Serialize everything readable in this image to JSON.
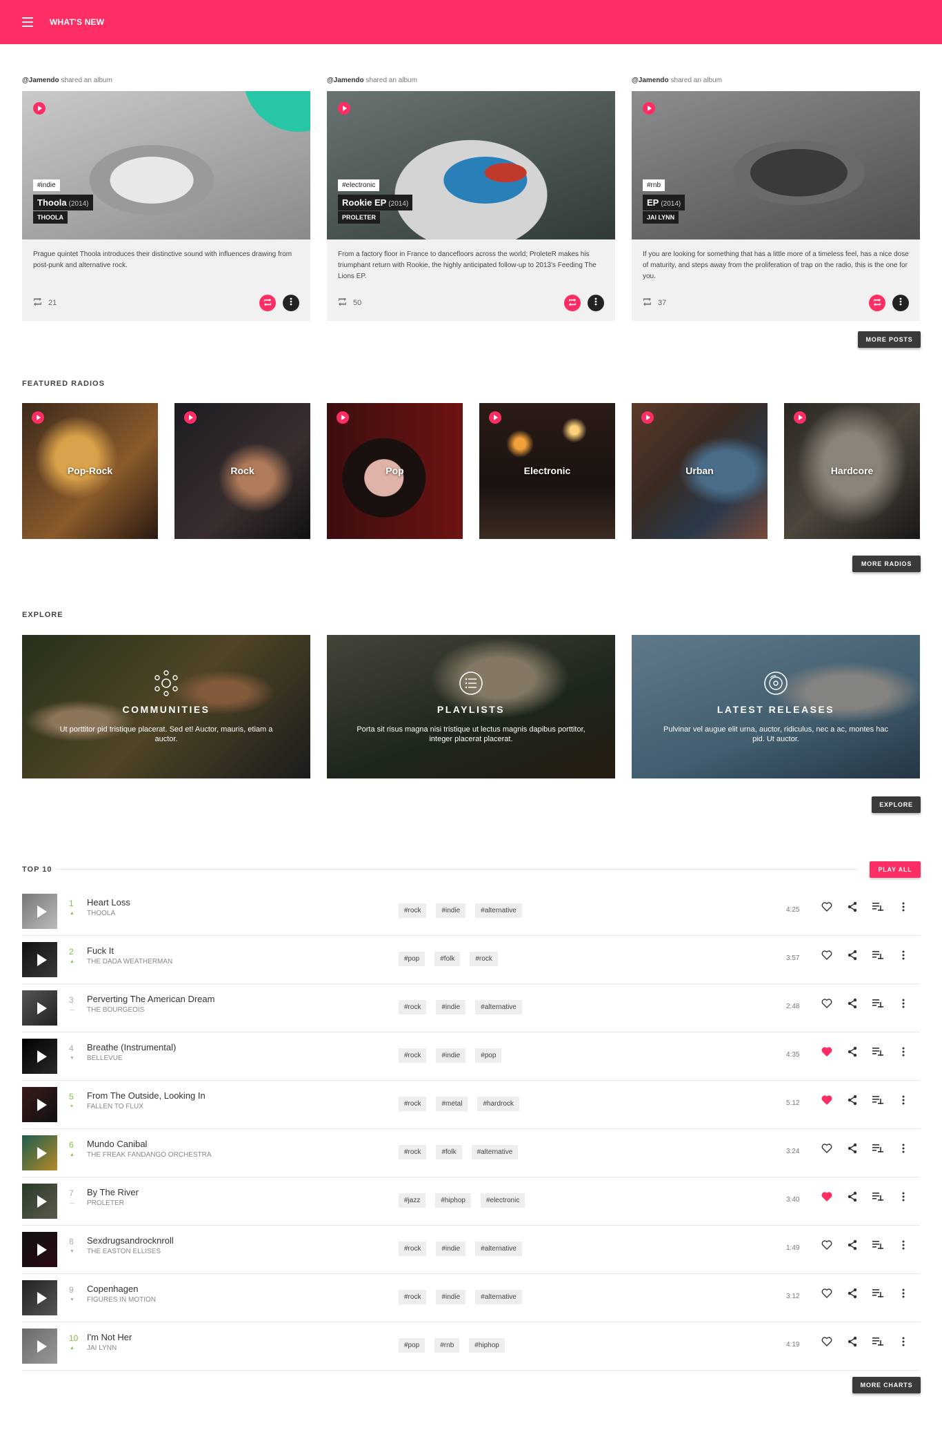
{
  "header": {
    "title": "WHAT'S NEW"
  },
  "posts": [
    {
      "user": "@Jamendo",
      "action": "shared an album",
      "tag": "#indie",
      "album": "Thoola",
      "year": "(2014)",
      "artist": "THOOLA",
      "description": "Prague quintet Thoola introduces their distinctive sound with influences drawing from post-punk and alternative rock.",
      "reposts": "21"
    },
    {
      "user": "@Jamendo",
      "action": "shared an album",
      "tag": "#electronic",
      "album": "Rookie EP",
      "year": "(2014)",
      "artist": "PROLETER",
      "description": "From a factory floor in France to dancefloors across the world; ProleteR makes his triumphant return with Rookie, the highly anticipated follow-up to 2013's Feeding The Lions EP.",
      "reposts": "50"
    },
    {
      "user": "@Jamendo",
      "action": "shared an album",
      "tag": "#rnb",
      "album": "EP",
      "year": "(2014)",
      "artist": "JAI LYNN",
      "description": "If you are looking for something that has a little more of a timeless feel, has a nice dose of maturity, and steps away from the proliferation of trap on the radio, this is the one for you.",
      "reposts": "37"
    }
  ],
  "more_posts": "MORE POSTS",
  "featured_radios": {
    "title": "FEATURED RADIOS",
    "items": [
      "Pop-Rock",
      "Rock",
      "Pop",
      "Electronic",
      "Urban",
      "Hardcore"
    ],
    "more": "MORE RADIOS"
  },
  "explore": {
    "title": "EXPLORE",
    "items": [
      {
        "title": "COMMUNITIES",
        "desc": "Ut porttitor pid tristique placerat. Sed et! Auctor, mauris, etiam a auctor."
      },
      {
        "title": "PLAYLISTS",
        "desc": "Porta sit risus magna nisi tristique ut lectus magnis dapibus porttitor, integer placerat placerat."
      },
      {
        "title": "LATEST RELEASES",
        "desc": "Pulvinar vel augue elit urna, auctor, ridiculus, nec a ac, montes hac pid. Ut auctor."
      }
    ],
    "button": "EXPLORE"
  },
  "top10": {
    "title": "TOP 10",
    "play_all": "PLAY ALL",
    "tracks": [
      {
        "rank": "1",
        "trend": "up",
        "title": "Heart Loss",
        "artist": "THOOLA",
        "tags": [
          "#rock",
          "#indie",
          "#alternative"
        ],
        "duration": "4:25",
        "liked": false
      },
      {
        "rank": "2",
        "trend": "up",
        "title": "Fuck It",
        "artist": "THE DADA WEATHERMAN",
        "tags": [
          "#pop",
          "#folk",
          "#rock"
        ],
        "duration": "3:57",
        "liked": false
      },
      {
        "rank": "3",
        "trend": "flat",
        "title": "Perverting The American Dream",
        "artist": "THE BOURGEOIS",
        "tags": [
          "#rock",
          "#indie",
          "#alternative"
        ],
        "duration": "2:48",
        "liked": false
      },
      {
        "rank": "4",
        "trend": "down",
        "title": "Breathe (Instrumental)",
        "artist": "BELLEVUE",
        "tags": [
          "#rock",
          "#indie",
          "#pop"
        ],
        "duration": "4:35",
        "liked": true
      },
      {
        "rank": "5",
        "trend": "new",
        "title": "From The Outside, Looking In",
        "artist": "FALLEN TO FLUX",
        "tags": [
          "#rock",
          "#metal",
          "#hardrock"
        ],
        "duration": "5:12",
        "liked": true
      },
      {
        "rank": "6",
        "trend": "up",
        "title": "Mundo Canibal",
        "artist": "THE FREAK FANDANGO ORCHESTRA",
        "tags": [
          "#rock",
          "#folk",
          "#alternative"
        ],
        "duration": "3:24",
        "liked": false
      },
      {
        "rank": "7",
        "trend": "flat",
        "title": "By The River",
        "artist": "PROLETER",
        "tags": [
          "#jazz",
          "#hiphop",
          "#electronic"
        ],
        "duration": "3:40",
        "liked": true
      },
      {
        "rank": "8",
        "trend": "down",
        "title": "Sexdrugsandrocknroll",
        "artist": "THE EASTON ELLISES",
        "tags": [
          "#rock",
          "#indie",
          "#alternative"
        ],
        "duration": "1:49",
        "liked": false
      },
      {
        "rank": "9",
        "trend": "down",
        "title": "Copenhagen",
        "artist": "FIGURES IN MOTION",
        "tags": [
          "#rock",
          "#indie",
          "#alternative"
        ],
        "duration": "3:12",
        "liked": false
      },
      {
        "rank": "10",
        "trend": "up",
        "title": "I'm Not Her",
        "artist": "JAI LYNN",
        "tags": [
          "#pop",
          "#rnb",
          "#hiphop"
        ],
        "duration": "4:19",
        "liked": false
      }
    ],
    "more": "MORE CHARTS"
  },
  "colors": {
    "accent": "#fe2d64",
    "up": "#82c341",
    "dark": "#3a3a3a"
  }
}
